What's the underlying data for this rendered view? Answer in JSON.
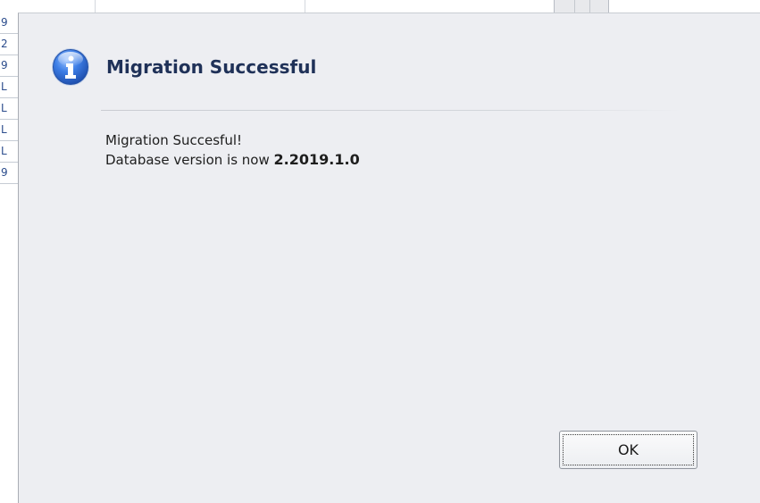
{
  "background": {
    "row_glyphs": [
      "9",
      "2",
      "9",
      "L",
      "L",
      "L",
      "L",
      "9"
    ]
  },
  "dialog": {
    "icon": "info-icon",
    "title": "Migration Successful",
    "message_line1": "Migration Succesful!",
    "message_line2_prefix": "Database version is now ",
    "version": "2.2019.1.0",
    "ok_label": "OK"
  },
  "colors": {
    "dialog_bg": "#edeef2",
    "title": "#1f3158",
    "icon_blue": "#2a63c8"
  }
}
